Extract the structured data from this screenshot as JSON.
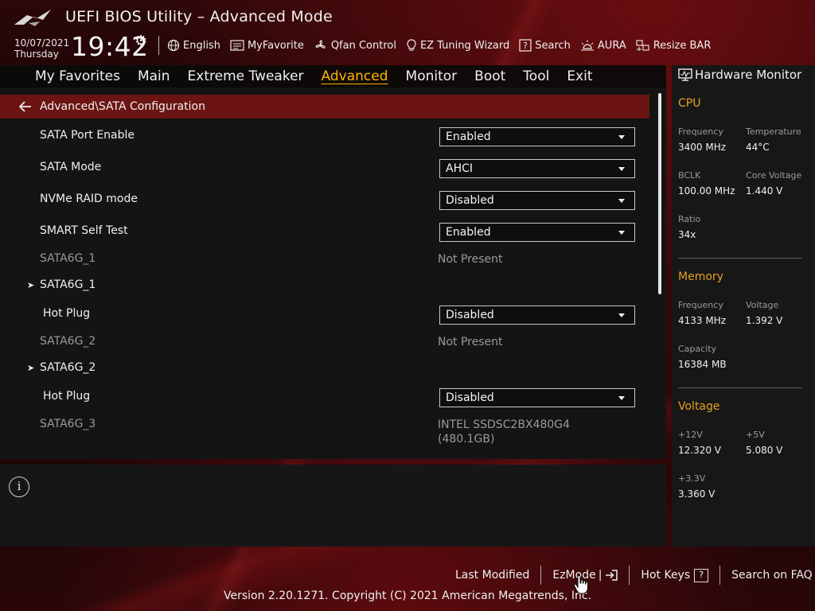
{
  "header": {
    "title": "UEFI BIOS Utility – Advanced Mode",
    "date": "10/07/2021",
    "day": "Thursday",
    "time": "19:42",
    "quicklinks": [
      {
        "label": "English",
        "icon": "globe-icon"
      },
      {
        "label": "MyFavorite",
        "icon": "favorite-list-icon"
      },
      {
        "label": "Qfan Control",
        "icon": "fan-icon"
      },
      {
        "label": "EZ Tuning Wizard",
        "icon": "lightbulb-icon"
      },
      {
        "label": "Search",
        "icon": "search-help-icon"
      },
      {
        "label": "AURA",
        "icon": "aura-light-icon"
      },
      {
        "label": "Resize BAR",
        "icon": "resize-bar-icon"
      }
    ]
  },
  "nav": {
    "tabs": [
      "My Favorites",
      "Main",
      "Extreme Tweaker",
      "Advanced",
      "Monitor",
      "Boot",
      "Tool",
      "Exit"
    ],
    "active": "Advanced"
  },
  "breadcrumb": "Advanced\\SATA Configuration",
  "settings": {
    "sata_port_enable": {
      "label": "SATA Port Enable",
      "value": "Enabled"
    },
    "sata_mode": {
      "label": "SATA Mode",
      "value": "AHCI"
    },
    "nvme_raid": {
      "label": "NVMe RAID mode",
      "value": "Disabled"
    },
    "smart_self_test": {
      "label": "SMART Self Test",
      "value": "Enabled"
    },
    "sata6g_1_info": {
      "label": "SATA6G_1",
      "value": "Not Present"
    },
    "sata6g_1_menu": {
      "label": "SATA6G_1"
    },
    "hot_plug_1": {
      "label": "Hot Plug",
      "value": "Disabled"
    },
    "sata6g_2_info": {
      "label": "SATA6G_2",
      "value": "Not Present"
    },
    "sata6g_2_menu": {
      "label": "SATA6G_2"
    },
    "hot_plug_2": {
      "label": "Hot Plug",
      "value": "Disabled"
    },
    "sata6g_3_info": {
      "label": "SATA6G_3",
      "value_line1": "INTEL SSDSC2BX480G4",
      "value_line2": "(480.1GB)"
    }
  },
  "hardware_monitor": {
    "title": "Hardware Monitor",
    "cpu": {
      "section": "CPU",
      "frequency_label": "Frequency",
      "frequency": "3400 MHz",
      "temperature_label": "Temperature",
      "temperature": "44°C",
      "bclk_label": "BCLK",
      "bclk": "100.00 MHz",
      "core_voltage_label": "Core Voltage",
      "core_voltage": "1.440 V",
      "ratio_label": "Ratio",
      "ratio": "34x"
    },
    "memory": {
      "section": "Memory",
      "frequency_label": "Frequency",
      "frequency": "4133 MHz",
      "voltage_label": "Voltage",
      "voltage": "1.392 V",
      "capacity_label": "Capacity",
      "capacity": "16384 MB"
    },
    "voltage": {
      "section": "Voltage",
      "v12_label": "+12V",
      "v12": "12.320 V",
      "v5_label": "+5V",
      "v5": "5.080 V",
      "v33_label": "+3.3V",
      "v33": "3.360 V"
    }
  },
  "footer": {
    "last_modified": "Last Modified",
    "ezmode": "EzMode",
    "ezmode_sep": "|",
    "hot_keys": "Hot Keys",
    "hot_keys_icon": "?",
    "search_faq": "Search on FAQ",
    "version": "Version 2.20.1271. Copyright (C) 2021 American Megatrends, Inc."
  },
  "colors": {
    "accent": "#ffb400",
    "section_header": "#e8a020",
    "breadcrumb_bg": "#6b1413"
  }
}
